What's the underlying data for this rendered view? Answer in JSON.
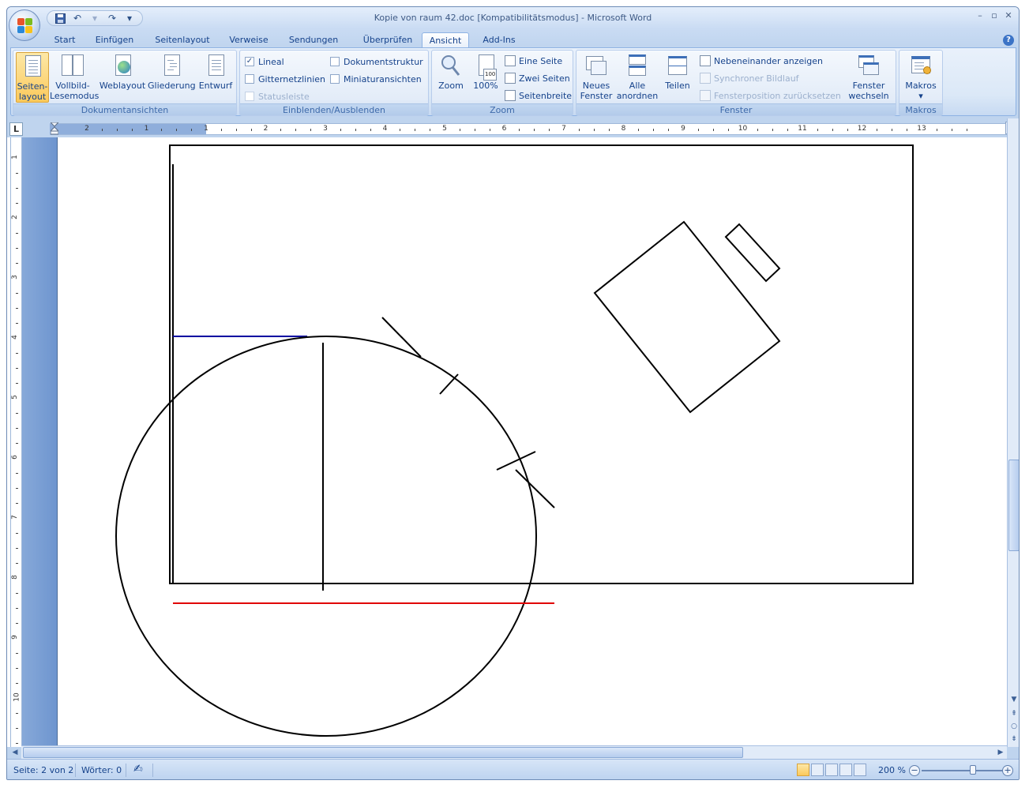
{
  "window": {
    "title": "Kopie von raum 42.doc [Kompatibilitätsmodus] - Microsoft Word"
  },
  "qat": {
    "save_icon": "save-icon",
    "undo_icon": "undo-icon",
    "redo_icon": "redo-icon"
  },
  "tabs": [
    {
      "label": "Start",
      "active": false
    },
    {
      "label": "Einfügen",
      "active": false
    },
    {
      "label": "Seitenlayout",
      "active": false
    },
    {
      "label": "Verweise",
      "active": false
    },
    {
      "label": "Sendungen",
      "active": false
    },
    {
      "label": "Überprüfen",
      "active": false
    },
    {
      "label": "Ansicht",
      "active": true
    },
    {
      "label": "Add-Ins",
      "active": false
    }
  ],
  "ribbon": {
    "dokumentansichten": {
      "label": "Dokumentansichten",
      "seitenlayout_1": "Seiten-",
      "seitenlayout_2": "layout",
      "vollbild_1": "Vollbild-",
      "vollbild_2": "Lesemodus",
      "weblayout": "Weblayout",
      "gliederung": "Gliederung",
      "entwurf": "Entwurf"
    },
    "einblenden": {
      "label": "Einblenden/Ausblenden",
      "lineal": "Lineal",
      "lineal_checked": true,
      "gitternetzlinien": "Gitternetzlinien",
      "statusleiste": "Statusleiste",
      "dokumentstruktur": "Dokumentstruktur",
      "miniaturansichten": "Miniaturansichten"
    },
    "zoom": {
      "label": "Zoom",
      "zoom": "Zoom",
      "hundred": "100%",
      "hundred_badge": "100",
      "eine_seite": "Eine Seite",
      "zwei_seiten": "Zwei Seiten",
      "seitenbreite": "Seitenbreite"
    },
    "fenster": {
      "label": "Fenster",
      "neues_1": "Neues",
      "neues_2": "Fenster",
      "alle_1": "Alle",
      "alle_2": "anordnen",
      "teilen": "Teilen",
      "nebeneinander": "Nebeneinander anzeigen",
      "synchroner": "Synchroner Bildlauf",
      "fensterposition": "Fensterposition zurücksetzen",
      "wechseln_1": "Fenster",
      "wechseln_2": "wechseln"
    },
    "makros": {
      "label": "Makros",
      "makros": "Makros"
    }
  },
  "ruler": {
    "h_numbers": [
      "2",
      "1",
      "1",
      "2",
      "3",
      "4",
      "5",
      "6",
      "7",
      "8",
      "9",
      "10",
      "11",
      "12",
      "13"
    ],
    "v_numbers": [
      "1",
      "2",
      "3",
      "4",
      "5",
      "6",
      "7",
      "8",
      "9",
      "10",
      "1"
    ]
  },
  "colors": {
    "accent_blue": "#15428b",
    "line_blue": "#0000a0",
    "line_red": "#e00000"
  },
  "status": {
    "seite": "Seite: 2 von 2",
    "woerter": "Wörter: 0",
    "zoom": "200 %"
  }
}
